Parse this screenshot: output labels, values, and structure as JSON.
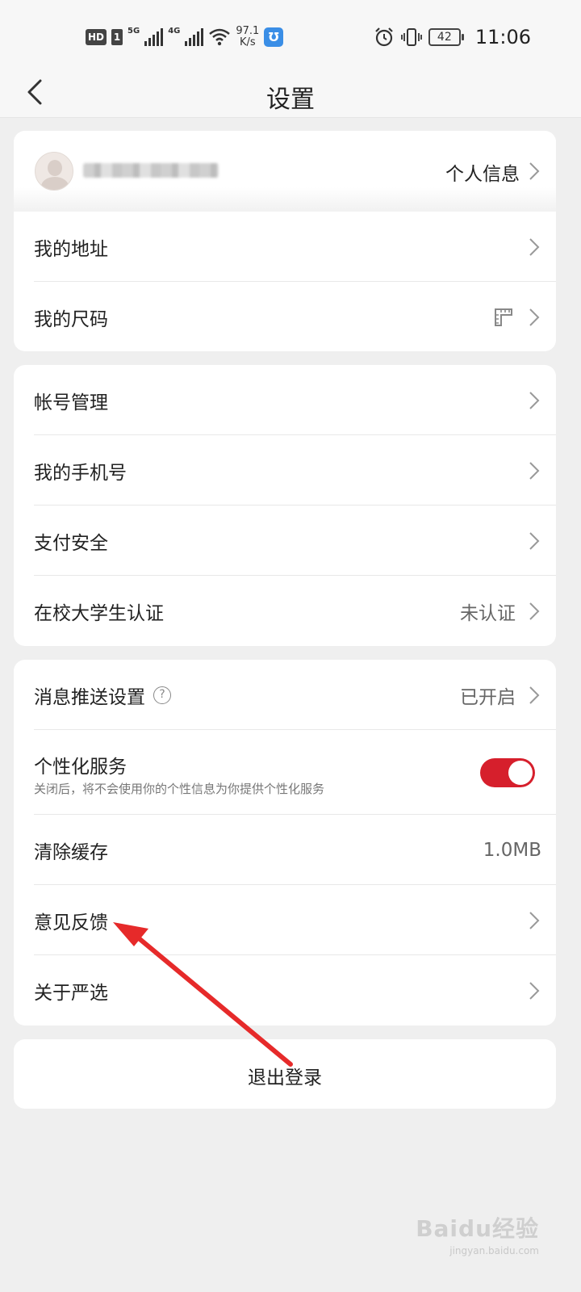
{
  "status_bar": {
    "hd": "HD",
    "sim": "1",
    "net1": "5G",
    "net2": "4G",
    "speed_value": "97.1",
    "speed_unit": "K/s",
    "battery": "42",
    "time": "11:06"
  },
  "header": {
    "title": "设置"
  },
  "profile": {
    "link_label": "个人信息"
  },
  "section1": {
    "items": [
      {
        "label": "我的地址"
      },
      {
        "label": "我的尺码"
      }
    ]
  },
  "section2": {
    "items": [
      {
        "label": "帐号管理"
      },
      {
        "label": "我的手机号"
      },
      {
        "label": "支付安全"
      },
      {
        "label": "在校大学生认证",
        "value": "未认证"
      }
    ]
  },
  "section3": {
    "items": [
      {
        "label": "消息推送设置",
        "value": "已开启"
      },
      {
        "label": "个性化服务",
        "sublabel": "关闭后，将不会使用你的个性信息为你提供个性化服务",
        "toggle_on": true
      },
      {
        "label": "清除缓存",
        "value": "1.0MB"
      },
      {
        "label": "意见反馈"
      },
      {
        "label": "关于严选"
      }
    ]
  },
  "logout": {
    "label": "退出登录"
  },
  "watermark": {
    "main": "Baidu经验",
    "sub": "jingyan.baidu.com"
  },
  "colors": {
    "accent": "#d61f2c",
    "annotation_arrow": "#e62a2a"
  }
}
